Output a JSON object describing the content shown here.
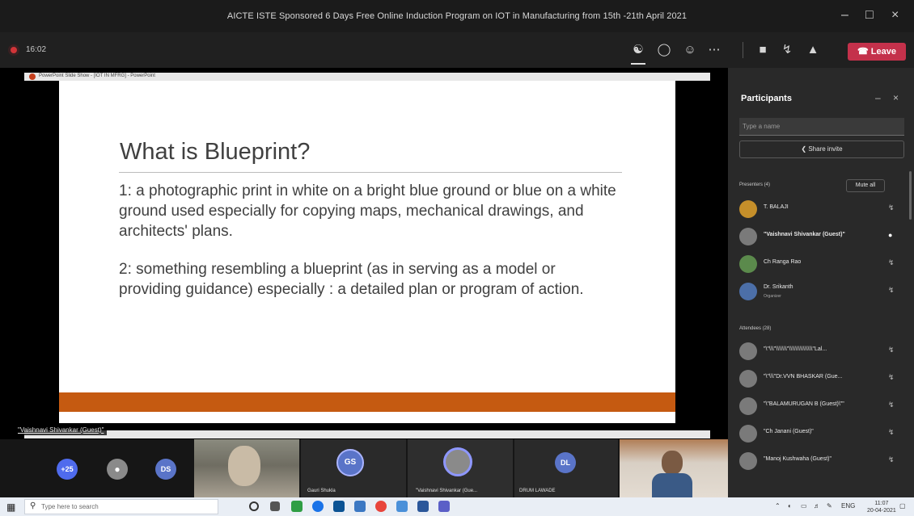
{
  "window": {
    "title": "AICTE ISTE Sponsored 6 Days Free Online Induction Program on IOT in Manufacturing from 15th -21th April 2021"
  },
  "meeting": {
    "elapsed": "16:02",
    "leave_label": "Leave",
    "colors": {
      "leave": "#c4314b",
      "record": "#d13438"
    }
  },
  "screen_share": {
    "window_title": "PowerPoint Slide Show - [IOT IN MFRG] - PowerPoint",
    "slide": {
      "heading": "What is Blueprint?",
      "point1": "1: a photographic print in white on a bright blue ground or blue on a white ground used especially for copying maps, mechanical drawings, and architects' plans.",
      "point2": "2: something resembling a blueprint (as in serving as a model or providing guidance) especially : a detailed plan or program of action.",
      "accent_color": "#c55a11"
    },
    "presenter_tag": "\"Vaishnavi Shivankar (Guest)\""
  },
  "gallery": {
    "overflow_count": "+25",
    "tiles": [
      {
        "initials": "DS"
      },
      {
        "initials": "GS",
        "name": "Gauri Shukla"
      },
      {
        "initials": "",
        "name": "\"Vaishnavi Shivankar (Gue..."
      },
      {
        "initials": "DL",
        "name": "DRUM LAWADE"
      }
    ]
  },
  "participants": {
    "title": "Participants",
    "search_placeholder": "Type a name",
    "share_invite": "Share invite",
    "presenters_header": "Presenters (4)",
    "mute_all": "Mute all",
    "presenters": [
      {
        "name": "T. BALAJI"
      },
      {
        "name": "\"Vaishnavi Shivankar (Guest)\""
      },
      {
        "name": "Ch Ranga Rao"
      },
      {
        "name": "Dr. Srikanth",
        "role": "Organizer"
      }
    ],
    "attendees_header": "Attendees (28)",
    "attendees": [
      {
        "name": "\"\\\"\\\\\\\"\\\\\\\\\\\\\\\"\\\\\\\\\\\\\\\\\\\\\\\\\\\\\\\"Lal..."
      },
      {
        "name": "\"\\\"\\\\\\\"Dr.VVN BHASKAR (Gue..."
      },
      {
        "name": "\"\\\"BALAMURUGAN B (Guest)\\\"\""
      },
      {
        "name": "\"Ch Janani (Guest)\""
      },
      {
        "name": "\"Manoj Kushwaha (Guest)\""
      }
    ]
  },
  "taskbar": {
    "search_placeholder": "Type here to search",
    "language": "ENG",
    "time": "11:07",
    "date": "20-04-2021"
  }
}
